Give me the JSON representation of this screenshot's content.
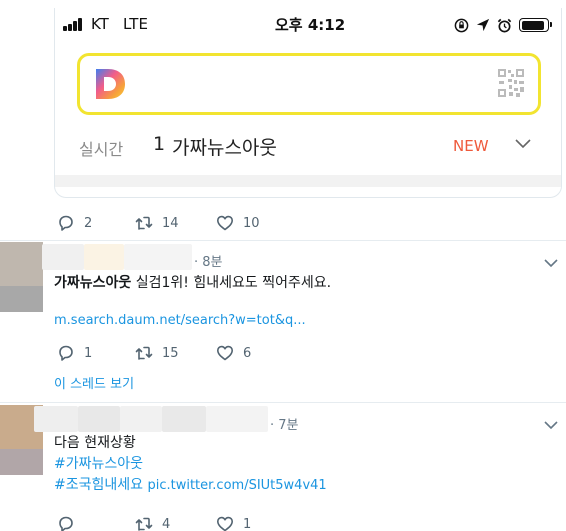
{
  "embedded_screenshot": {
    "status_bar": {
      "carrier": "KT",
      "network": "LTE",
      "time": "오후 4:12"
    },
    "realtime": {
      "label": "실시간",
      "rank": "1",
      "keyword": "가짜뉴스아웃",
      "badge": "NEW"
    }
  },
  "tweet0": {
    "replies": "2",
    "retweets": "14",
    "likes": "10"
  },
  "tweet1": {
    "time": "· 8분",
    "hashtag_text": "가짜뉴스아웃",
    "body_text": " 실검1위! 힘내세요도 찍어주세요.",
    "link": "m.search.daum.net/search?w=tot&q...",
    "replies": "1",
    "retweets": "15",
    "likes": "6",
    "thread_label": "이 스레드 보기"
  },
  "tweet2": {
    "time": "· 7분",
    "line1": "다음 현재상황",
    "hashtag1": "#가짜뉴스아웃",
    "hashtag2": "#조국힘내세요",
    "pic_link": "pic.twitter.com/SIUt5w4v41",
    "replies": "",
    "retweets": "4",
    "likes": "1"
  },
  "colors": {
    "link": "#1b95e0",
    "search_border": "#f2e430",
    "new_badge": "#ef5a3c",
    "meta_text": "#657786"
  },
  "icons": [
    "reply-icon",
    "retweet-icon",
    "like-icon",
    "chevron-down-icon",
    "qr-code-icon",
    "daum-logo-icon"
  ]
}
